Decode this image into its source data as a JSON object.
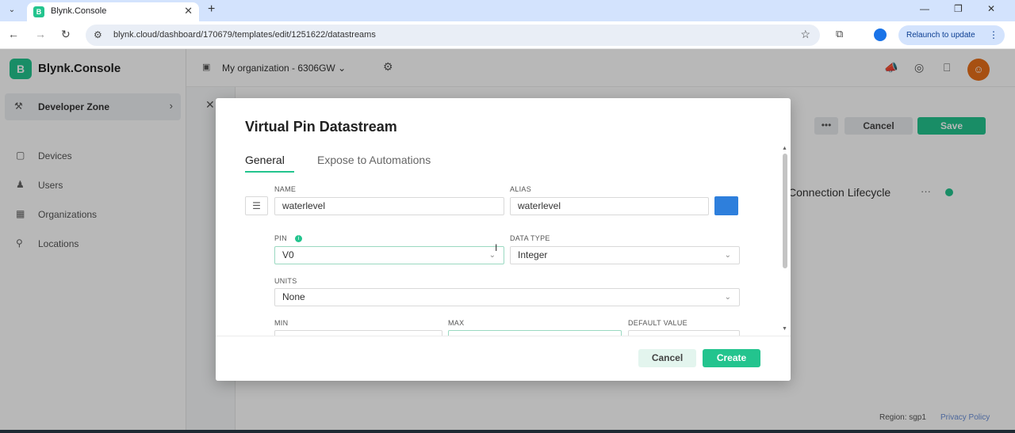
{
  "browser": {
    "tab_title": "Blynk.Console",
    "tab_favicon": "B",
    "url": "blynk.cloud/dashboard/170679/templates/edit/1251622/datastreams",
    "relaunch_label": "Relaunch to update"
  },
  "app": {
    "brand": "Blynk.Console",
    "brand_letter": "B",
    "sidebar": {
      "developer_zone": "Developer Zone",
      "items": [
        {
          "label": "Devices",
          "icon": "cube-icon"
        },
        {
          "label": "Users",
          "icon": "users-icon"
        },
        {
          "label": "Organizations",
          "icon": "building-icon"
        },
        {
          "label": "Locations",
          "icon": "pin-icon"
        }
      ]
    },
    "org_name": "My organization - 6306GW",
    "page_actions": {
      "more": "•••",
      "cancel": "Cancel",
      "save": "Save"
    },
    "connection_label": "Connection Lifecycle",
    "footer": {
      "region": "Region: sgp1",
      "privacy": "Privacy Policy"
    }
  },
  "modal": {
    "title": "Virtual Pin Datastream",
    "tabs": [
      "General",
      "Expose to Automations"
    ],
    "fields": {
      "name": {
        "label": "NAME",
        "value": "waterlevel"
      },
      "alias": {
        "label": "ALIAS",
        "value": "waterlevel"
      },
      "pin": {
        "label": "PIN",
        "value": "V0"
      },
      "data_type": {
        "label": "DATA TYPE",
        "value": "Integer"
      },
      "units": {
        "label": "UNITS",
        "value": "None"
      },
      "min": {
        "label": "MIN"
      },
      "max": {
        "label": "MAX"
      },
      "default_value": {
        "label": "DEFAULT VALUE"
      }
    },
    "color": "#2e7fdc",
    "cancel_label": "Cancel",
    "create_label": "Create"
  },
  "colors": {
    "accent": "#23c48e"
  }
}
